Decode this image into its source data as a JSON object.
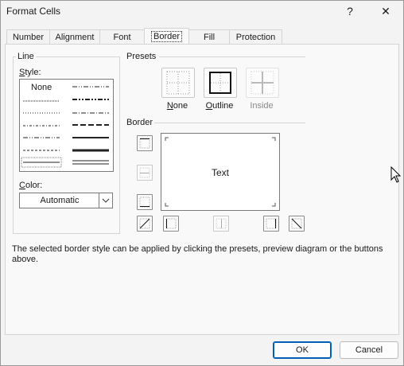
{
  "window": {
    "title": "Format Cells",
    "help_glyph": "?",
    "close_glyph": "✕"
  },
  "tabs": [
    {
      "label": "Number",
      "active": false
    },
    {
      "label": "Alignment",
      "active": false
    },
    {
      "label": "Font",
      "active": false
    },
    {
      "label": "Border",
      "active": true
    },
    {
      "label": "Fill",
      "active": false
    },
    {
      "label": "Protection",
      "active": false
    }
  ],
  "line_group": {
    "title": "Line",
    "style_label": "Style:",
    "style_none_label": "None",
    "color_label": "Color:",
    "color_value": "Automatic",
    "color_value_hex": "#000000"
  },
  "presets": {
    "title": "Presets",
    "items": [
      {
        "label": "None",
        "enabled": true,
        "icon": "preset-none-icon"
      },
      {
        "label": "Outline",
        "enabled": true,
        "icon": "preset-outline-icon"
      },
      {
        "label": "Inside",
        "enabled": false,
        "icon": "preset-inside-icon"
      }
    ]
  },
  "border": {
    "title": "Border",
    "preview_text": "Text"
  },
  "description": "The selected border style can be applied by clicking the presets, preview diagram or the buttons above.",
  "buttons": {
    "ok": "OK",
    "cancel": "Cancel"
  },
  "colors": {
    "accent": "#005fb8",
    "window_bg": "#f3f3f3",
    "panel_bg": "#f9f9f9",
    "disabled_text": "#8a8a8a"
  }
}
